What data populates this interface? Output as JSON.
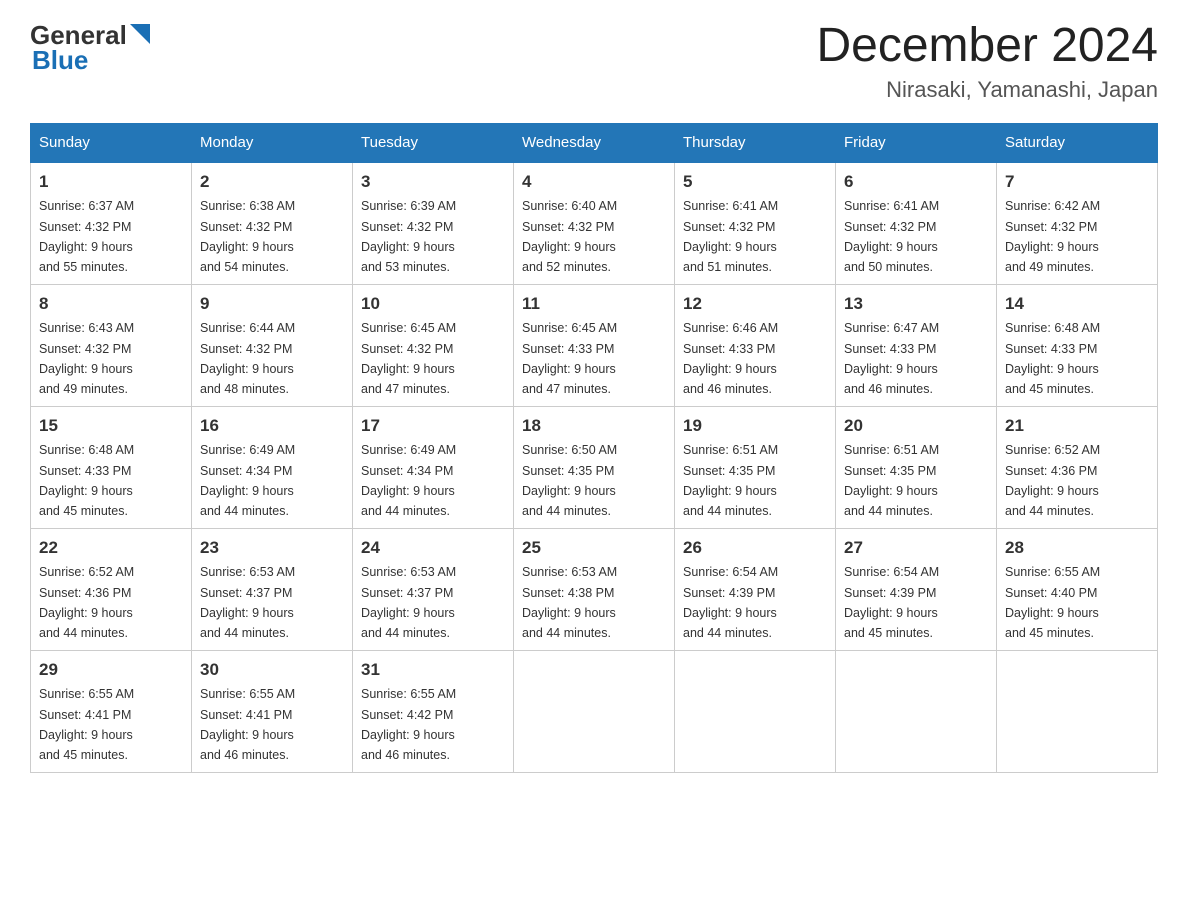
{
  "header": {
    "logo_general": "General",
    "logo_blue": "Blue",
    "month_title": "December 2024",
    "location": "Nirasaki, Yamanashi, Japan"
  },
  "days_of_week": [
    "Sunday",
    "Monday",
    "Tuesday",
    "Wednesday",
    "Thursday",
    "Friday",
    "Saturday"
  ],
  "weeks": [
    [
      {
        "day": "1",
        "sunrise": "6:37 AM",
        "sunset": "4:32 PM",
        "daylight": "9 hours and 55 minutes."
      },
      {
        "day": "2",
        "sunrise": "6:38 AM",
        "sunset": "4:32 PM",
        "daylight": "9 hours and 54 minutes."
      },
      {
        "day": "3",
        "sunrise": "6:39 AM",
        "sunset": "4:32 PM",
        "daylight": "9 hours and 53 minutes."
      },
      {
        "day": "4",
        "sunrise": "6:40 AM",
        "sunset": "4:32 PM",
        "daylight": "9 hours and 52 minutes."
      },
      {
        "day": "5",
        "sunrise": "6:41 AM",
        "sunset": "4:32 PM",
        "daylight": "9 hours and 51 minutes."
      },
      {
        "day": "6",
        "sunrise": "6:41 AM",
        "sunset": "4:32 PM",
        "daylight": "9 hours and 50 minutes."
      },
      {
        "day": "7",
        "sunrise": "6:42 AM",
        "sunset": "4:32 PM",
        "daylight": "9 hours and 49 minutes."
      }
    ],
    [
      {
        "day": "8",
        "sunrise": "6:43 AM",
        "sunset": "4:32 PM",
        "daylight": "9 hours and 49 minutes."
      },
      {
        "day": "9",
        "sunrise": "6:44 AM",
        "sunset": "4:32 PM",
        "daylight": "9 hours and 48 minutes."
      },
      {
        "day": "10",
        "sunrise": "6:45 AM",
        "sunset": "4:32 PM",
        "daylight": "9 hours and 47 minutes."
      },
      {
        "day": "11",
        "sunrise": "6:45 AM",
        "sunset": "4:33 PM",
        "daylight": "9 hours and 47 minutes."
      },
      {
        "day": "12",
        "sunrise": "6:46 AM",
        "sunset": "4:33 PM",
        "daylight": "9 hours and 46 minutes."
      },
      {
        "day": "13",
        "sunrise": "6:47 AM",
        "sunset": "4:33 PM",
        "daylight": "9 hours and 46 minutes."
      },
      {
        "day": "14",
        "sunrise": "6:48 AM",
        "sunset": "4:33 PM",
        "daylight": "9 hours and 45 minutes."
      }
    ],
    [
      {
        "day": "15",
        "sunrise": "6:48 AM",
        "sunset": "4:33 PM",
        "daylight": "9 hours and 45 minutes."
      },
      {
        "day": "16",
        "sunrise": "6:49 AM",
        "sunset": "4:34 PM",
        "daylight": "9 hours and 44 minutes."
      },
      {
        "day": "17",
        "sunrise": "6:49 AM",
        "sunset": "4:34 PM",
        "daylight": "9 hours and 44 minutes."
      },
      {
        "day": "18",
        "sunrise": "6:50 AM",
        "sunset": "4:35 PM",
        "daylight": "9 hours and 44 minutes."
      },
      {
        "day": "19",
        "sunrise": "6:51 AM",
        "sunset": "4:35 PM",
        "daylight": "9 hours and 44 minutes."
      },
      {
        "day": "20",
        "sunrise": "6:51 AM",
        "sunset": "4:35 PM",
        "daylight": "9 hours and 44 minutes."
      },
      {
        "day": "21",
        "sunrise": "6:52 AM",
        "sunset": "4:36 PM",
        "daylight": "9 hours and 44 minutes."
      }
    ],
    [
      {
        "day": "22",
        "sunrise": "6:52 AM",
        "sunset": "4:36 PM",
        "daylight": "9 hours and 44 minutes."
      },
      {
        "day": "23",
        "sunrise": "6:53 AM",
        "sunset": "4:37 PM",
        "daylight": "9 hours and 44 minutes."
      },
      {
        "day": "24",
        "sunrise": "6:53 AM",
        "sunset": "4:37 PM",
        "daylight": "9 hours and 44 minutes."
      },
      {
        "day": "25",
        "sunrise": "6:53 AM",
        "sunset": "4:38 PM",
        "daylight": "9 hours and 44 minutes."
      },
      {
        "day": "26",
        "sunrise": "6:54 AM",
        "sunset": "4:39 PM",
        "daylight": "9 hours and 44 minutes."
      },
      {
        "day": "27",
        "sunrise": "6:54 AM",
        "sunset": "4:39 PM",
        "daylight": "9 hours and 45 minutes."
      },
      {
        "day": "28",
        "sunrise": "6:55 AM",
        "sunset": "4:40 PM",
        "daylight": "9 hours and 45 minutes."
      }
    ],
    [
      {
        "day": "29",
        "sunrise": "6:55 AM",
        "sunset": "4:41 PM",
        "daylight": "9 hours and 45 minutes."
      },
      {
        "day": "30",
        "sunrise": "6:55 AM",
        "sunset": "4:41 PM",
        "daylight": "9 hours and 46 minutes."
      },
      {
        "day": "31",
        "sunrise": "6:55 AM",
        "sunset": "4:42 PM",
        "daylight": "9 hours and 46 minutes."
      },
      null,
      null,
      null,
      null
    ]
  ],
  "labels": {
    "sunrise": "Sunrise:",
    "sunset": "Sunset:",
    "daylight": "Daylight:"
  }
}
